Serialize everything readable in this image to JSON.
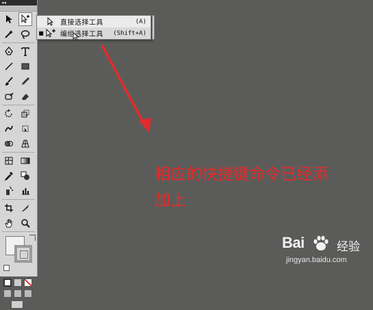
{
  "toolbar": {
    "grip_label": "◂◂",
    "rows": [
      [
        "selection-arrow-icon",
        "direct-select-add-icon"
      ],
      [
        "magic-wand-icon",
        "lasso-icon"
      ],
      [
        "pen-icon",
        "type-icon"
      ],
      [
        "line-icon",
        "rectangle-icon"
      ],
      [
        "paintbrush-icon",
        "pencil-icon"
      ],
      [
        "rotate-icon",
        "scale-icon"
      ],
      [
        "warp-icon",
        "free-transform-icon"
      ],
      [
        "symbol-sprayer-icon",
        "graph-icon"
      ],
      [
        "mesh-icon",
        "gradient-icon"
      ],
      [
        "eyedropper-icon",
        "blend-icon"
      ],
      [
        "crop-icon",
        "knife-icon"
      ],
      [
        "hand-icon",
        "zoom-icon"
      ]
    ]
  },
  "flyout_menu": {
    "items": [
      {
        "label": "直接选择工具",
        "shortcut": "(A)",
        "checked": false,
        "icon": "direct-selection-icon"
      },
      {
        "label": "编组选择工具",
        "shortcut": "(Shift+A)",
        "checked": true,
        "icon": "group-selection-icon"
      }
    ],
    "check_glyph": "■"
  },
  "annotation": {
    "text": "相应的快捷键命令已经添\n加上",
    "color": "#e32b2b"
  },
  "watermark": {
    "brand": "Bai",
    "brand_cn": "经验",
    "url": "jingyan.baidu.com"
  },
  "colors": {
    "canvas": "#5b5c5a",
    "panel": "#d6d6d6",
    "annotation_red": "#e32b2b"
  }
}
